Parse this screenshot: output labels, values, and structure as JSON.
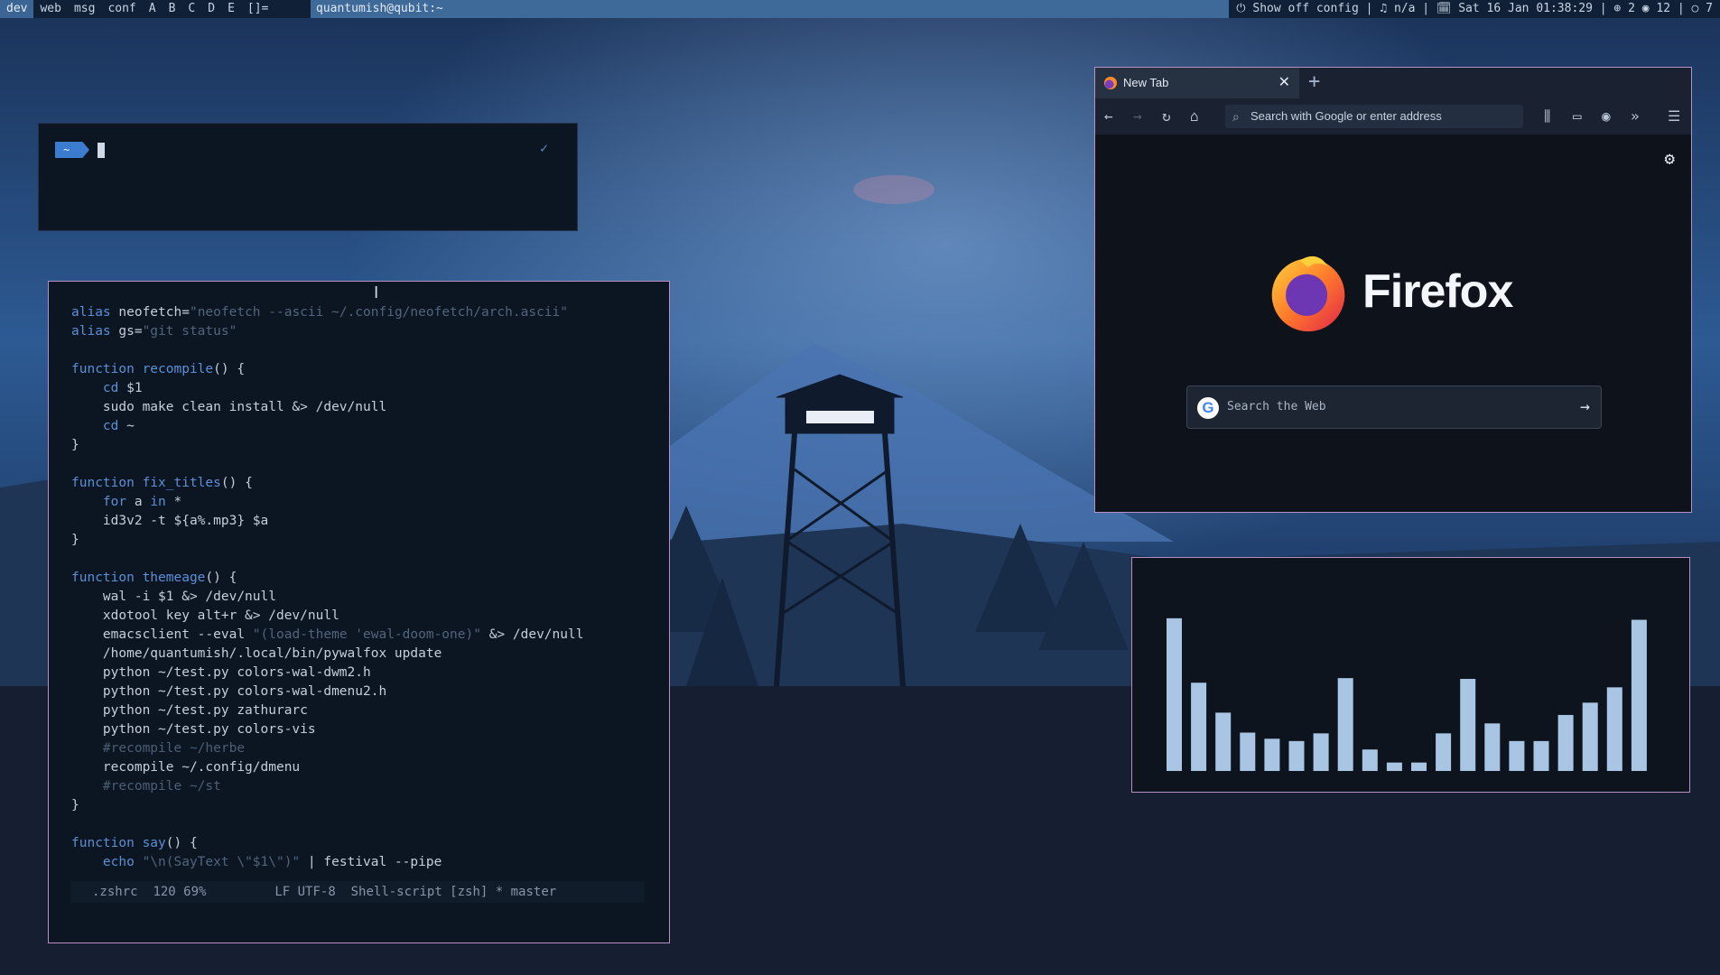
{
  "topbar": {
    "tags": [
      "dev",
      "web",
      "msg",
      "conf",
      "A",
      "B",
      "C",
      "D",
      "E",
      "[]="
    ],
    "active_tag": "dev",
    "window_title": "quantumish@qubit:~",
    "status": "⏻ Show off config | ♫ n/a | 🗓 Sat 16 Jan 01:38:29 | ⊕ 2 ◉ 12 | ○ 7"
  },
  "terminal": {
    "prompt": "~"
  },
  "emacs": {
    "lines": [
      [
        [
          "kw",
          "alias"
        ],
        [
          "txt",
          " neofetch="
        ],
        [
          "str",
          "\"neofetch --ascii ~/.config/neofetch/arch.ascii\""
        ]
      ],
      [
        [
          "kw",
          "alias"
        ],
        [
          "txt",
          " gs="
        ],
        [
          "str",
          "\"git status\""
        ]
      ],
      [],
      [
        [
          "kw",
          "function"
        ],
        [
          "txt",
          " "
        ],
        [
          "var",
          "recompile"
        ],
        [
          "txt",
          "() {"
        ]
      ],
      [
        [
          "txt",
          "    "
        ],
        [
          "kw",
          "cd"
        ],
        [
          "txt",
          " $1"
        ]
      ],
      [
        [
          "txt",
          "    sudo make clean install &> /dev/null"
        ]
      ],
      [
        [
          "txt",
          "    "
        ],
        [
          "kw",
          "cd"
        ],
        [
          "txt",
          " ~"
        ]
      ],
      [
        [
          "txt",
          "}"
        ]
      ],
      [],
      [
        [
          "kw",
          "function"
        ],
        [
          "txt",
          " "
        ],
        [
          "var",
          "fix_titles"
        ],
        [
          "txt",
          "() {"
        ]
      ],
      [
        [
          "txt",
          "    "
        ],
        [
          "kw",
          "for"
        ],
        [
          "txt",
          " a "
        ],
        [
          "kw",
          "in"
        ],
        [
          "txt",
          " *"
        ]
      ],
      [
        [
          "txt",
          "    id3v2 -t ${a%.mp3} $a"
        ]
      ],
      [
        [
          "txt",
          "}"
        ]
      ],
      [],
      [
        [
          "kw",
          "function"
        ],
        [
          "txt",
          " "
        ],
        [
          "var",
          "themeage"
        ],
        [
          "txt",
          "() {"
        ]
      ],
      [
        [
          "txt",
          "    wal -i $1 &> /dev/null"
        ]
      ],
      [
        [
          "txt",
          "    xdotool key alt+r &> /dev/null"
        ]
      ],
      [
        [
          "txt",
          "    emacsclient --eval "
        ],
        [
          "str",
          "\"(load-theme 'ewal-doom-one)\""
        ],
        [
          "txt",
          " &> /dev/null"
        ]
      ],
      [
        [
          "txt",
          "    /home/quantumish/.local/bin/pywalfox update"
        ]
      ],
      [
        [
          "txt",
          "    python ~/test.py colors-wal-dwm2.h"
        ]
      ],
      [
        [
          "txt",
          "    python ~/test.py colors-wal-dmenu2.h"
        ]
      ],
      [
        [
          "txt",
          "    python ~/test.py zathurarc"
        ]
      ],
      [
        [
          "txt",
          "    python ~/test.py colors-vis"
        ]
      ],
      [
        [
          "txt",
          "    "
        ],
        [
          "cm",
          "#recompile ~/herbe"
        ]
      ],
      [
        [
          "txt",
          "    recompile ~/.config/dmenu"
        ]
      ],
      [
        [
          "txt",
          "    "
        ],
        [
          "cm",
          "#recompile ~/st"
        ]
      ],
      [
        [
          "txt",
          "}"
        ]
      ],
      [],
      [
        [
          "kw",
          "function"
        ],
        [
          "txt",
          " "
        ],
        [
          "var",
          "say"
        ],
        [
          "txt",
          "() {"
        ]
      ],
      [
        [
          "txt",
          "    "
        ],
        [
          "kw",
          "echo"
        ],
        [
          "txt",
          " "
        ],
        [
          "str",
          "\"\\n(SayText \\\"$1\\\")\""
        ],
        [
          "txt",
          " | festival --pipe"
        ]
      ]
    ],
    "modeline": {
      "file": ".zshrc",
      "position": "120 69%",
      "encoding": "LF UTF-8",
      "mode": "Shell-script [zsh] * master"
    }
  },
  "firefox": {
    "tab_title": "New Tab",
    "url_placeholder": "Search with Google or enter address",
    "wordmark": "Firefox",
    "search_placeholder": "Search the Web"
  },
  "visualizer": {
    "bar_color": "#a8c6e4",
    "levels": [
      0.995,
      0.575,
      0.38,
      0.25,
      0.21,
      0.195,
      0.245,
      0.605,
      0.14,
      0.055,
      0.055,
      0.245,
      0.6,
      0.31,
      0.195,
      0.195,
      0.365,
      0.445,
      0.545,
      0.985
    ]
  }
}
